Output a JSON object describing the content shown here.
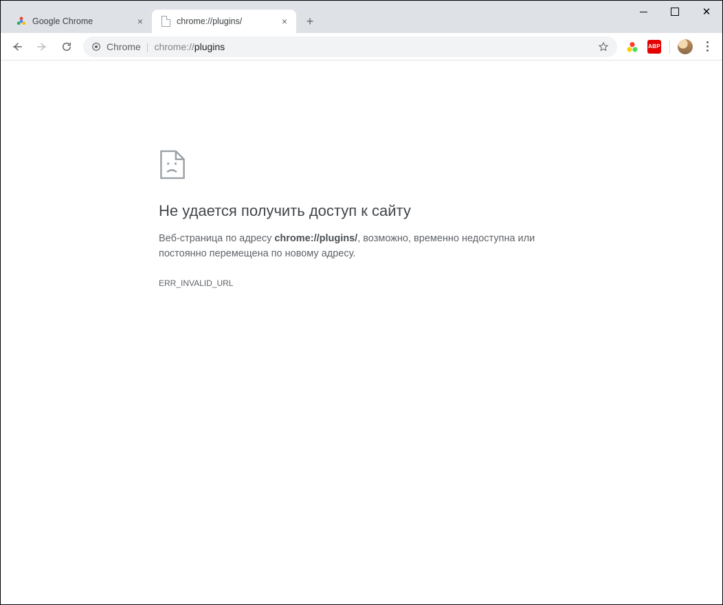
{
  "window": {
    "tabs": [
      {
        "title": "Google Chrome",
        "active": false
      },
      {
        "title": "chrome://plugins/",
        "active": true
      }
    ]
  },
  "omnibox": {
    "origin_label": "Chrome",
    "url_scheme": "chrome://",
    "url_path": "plugins"
  },
  "extensions": {
    "abp_label": "ABP"
  },
  "error": {
    "title": "Не удается получить доступ к сайту",
    "desc_prefix": "Веб-страница по адресу ",
    "desc_url": "chrome://plugins/",
    "desc_suffix": ", возможно, временно недоступна или постоянно перемещена по новому адресу.",
    "code": "ERR_INVALID_URL"
  }
}
